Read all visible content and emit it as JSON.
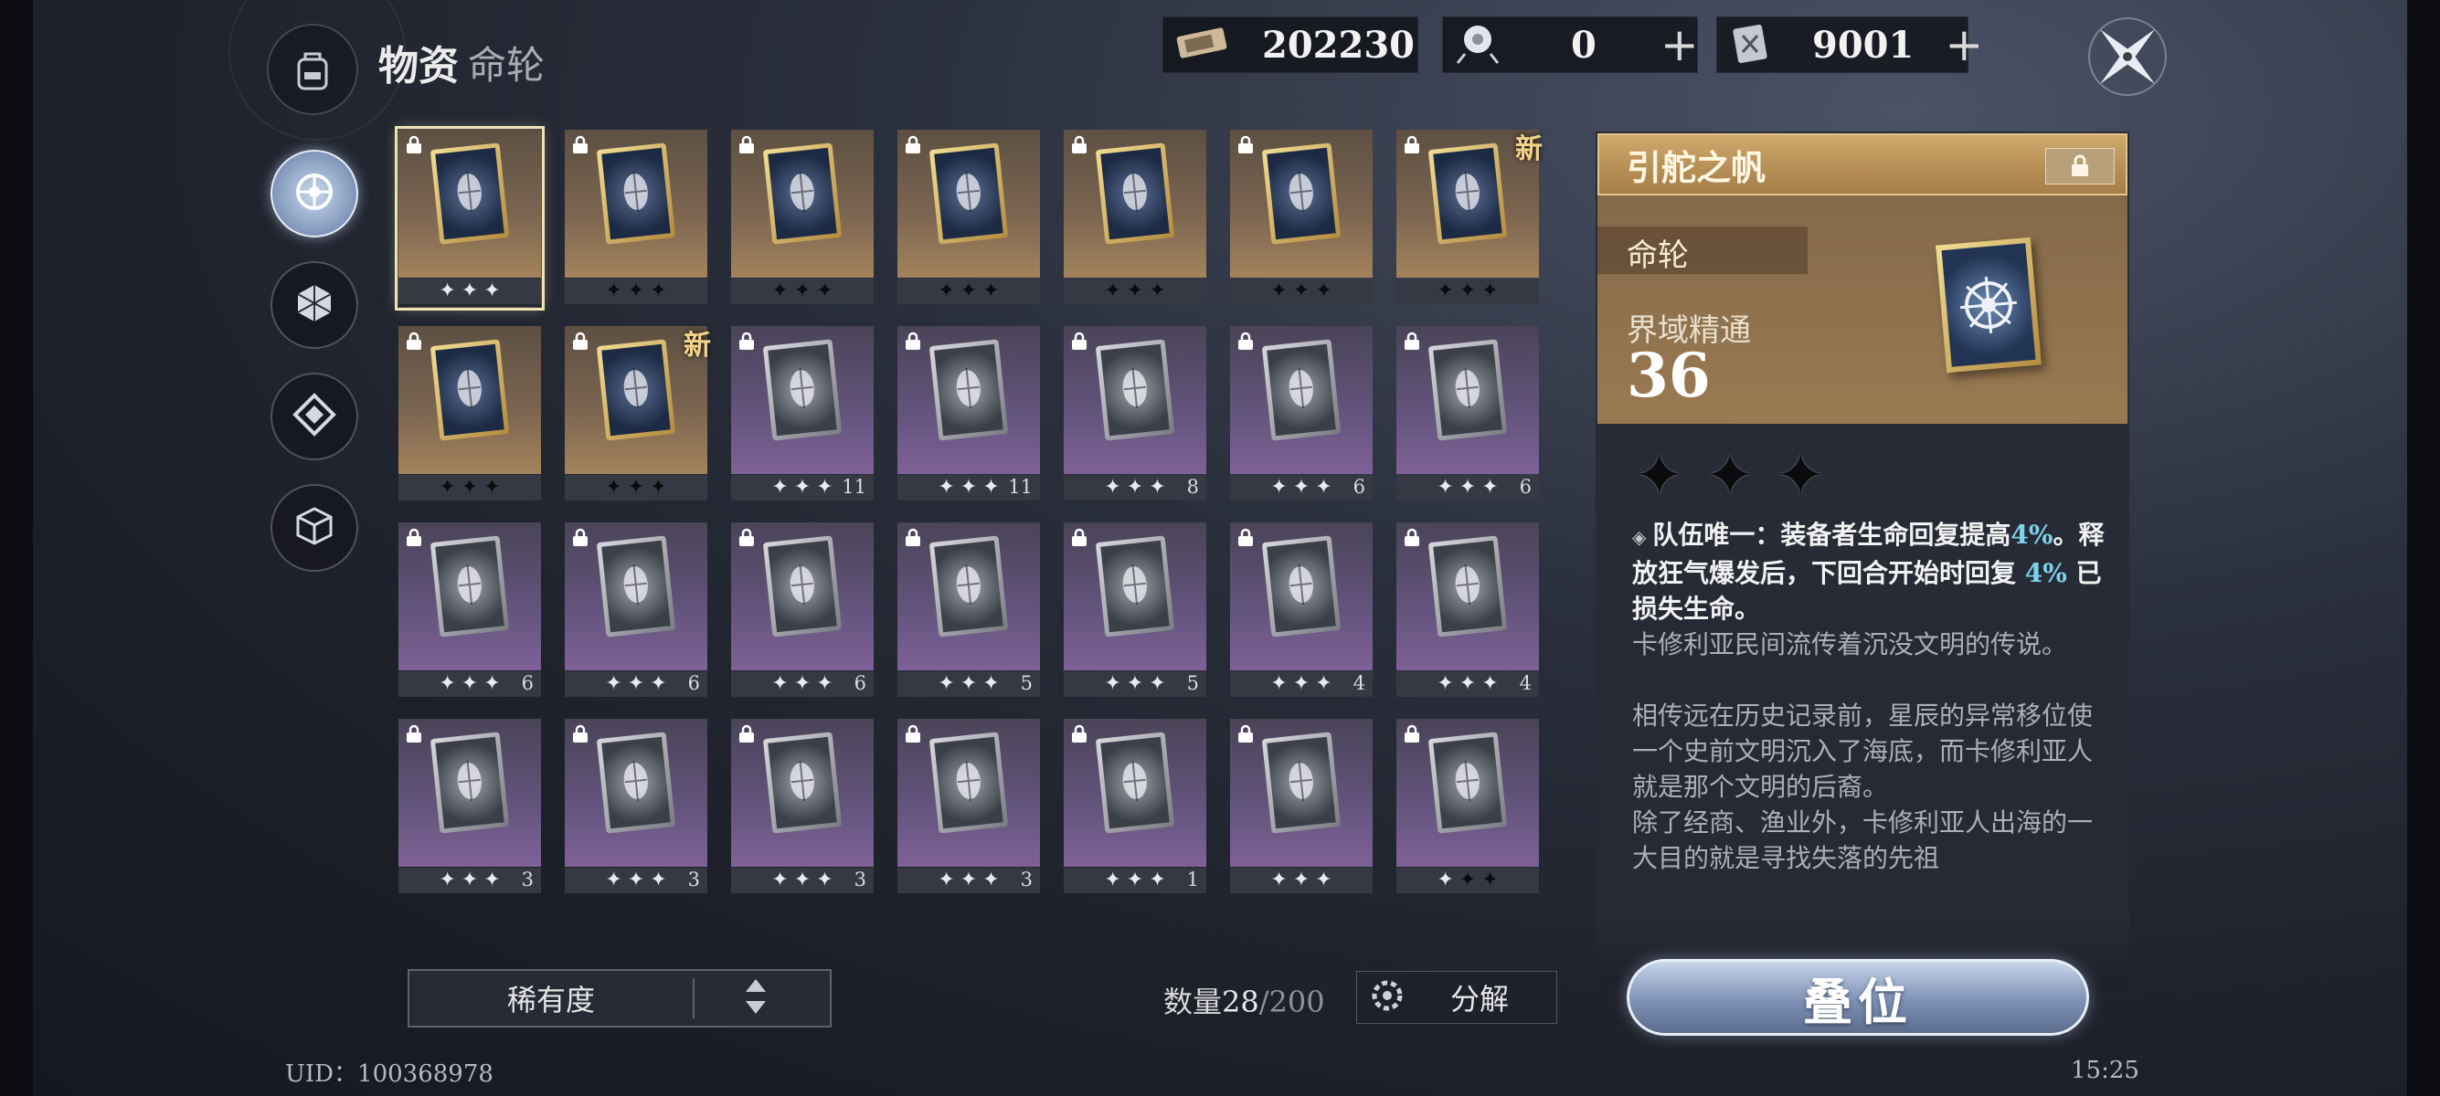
{
  "header": {
    "title": "物资",
    "subtitle": "命轮"
  },
  "currencies": [
    {
      "icon": "ticket-icon",
      "value": "202230",
      "plus": false
    },
    {
      "icon": "orb-icon",
      "value": "0",
      "plus": true,
      "plus_label": "+"
    },
    {
      "icon": "crystal-icon",
      "value": "9001",
      "plus": true,
      "plus_label": "+"
    }
  ],
  "nav": [
    "wheel-icon",
    "hexagon-icon",
    "diamond-icon",
    "cube-icon"
  ],
  "grid": [
    {
      "rarity": "gold",
      "icon": "wheel-icon",
      "stars": 3,
      "filled": 0,
      "level": "",
      "new": false,
      "selected": true
    },
    {
      "rarity": "gold",
      "icon": "figure-icon",
      "stars": 3,
      "filled": 3,
      "level": "",
      "new": false
    },
    {
      "rarity": "gold",
      "icon": "robe-icon",
      "stars": 3,
      "filled": 3,
      "level": "",
      "new": false
    },
    {
      "rarity": "gold",
      "icon": "sword-icon",
      "stars": 3,
      "filled": 3,
      "level": "",
      "new": false
    },
    {
      "rarity": "gold",
      "icon": "emblem-icon",
      "stars": 3,
      "filled": 3,
      "level": "",
      "new": false
    },
    {
      "rarity": "gold",
      "icon": "mirror-icon",
      "stars": 3,
      "filled": 3,
      "level": "",
      "new": false
    },
    {
      "rarity": "gold",
      "icon": "beast-icon",
      "stars": 3,
      "filled": 3,
      "level": "",
      "new": true
    },
    {
      "rarity": "gold",
      "icon": "beast-icon",
      "stars": 3,
      "filled": 3,
      "level": "",
      "new": false
    },
    {
      "rarity": "gold",
      "icon": "beast-icon",
      "stars": 3,
      "filled": 3,
      "level": "",
      "new": true
    },
    {
      "rarity": "purple",
      "icon": "staff-icon",
      "stars": 3,
      "filled": 0,
      "level": "11",
      "new": false
    },
    {
      "rarity": "purple",
      "icon": "shards-icon",
      "stars": 3,
      "filled": 0,
      "level": "11",
      "new": false
    },
    {
      "rarity": "purple",
      "icon": "hourglass-icon",
      "stars": 3,
      "filled": 0,
      "level": "8",
      "new": false
    },
    {
      "rarity": "purple",
      "icon": "flower-icon",
      "stars": 3,
      "filled": 0,
      "level": "6",
      "new": false
    },
    {
      "rarity": "purple",
      "icon": "spiral-icon",
      "stars": 3,
      "filled": 0,
      "level": "6",
      "new": false
    },
    {
      "rarity": "purple",
      "icon": "target-icon",
      "stars": 3,
      "filled": 0,
      "level": "6",
      "new": false
    },
    {
      "rarity": "purple",
      "icon": "key-icon",
      "stars": 3,
      "filled": 0,
      "level": "6",
      "new": false
    },
    {
      "rarity": "purple",
      "icon": "cat-icon",
      "stars": 3,
      "filled": 0,
      "level": "6",
      "new": false
    },
    {
      "rarity": "purple",
      "icon": "goblet-icon",
      "stars": 3,
      "filled": 0,
      "level": "5",
      "new": false
    },
    {
      "rarity": "purple",
      "icon": "cards-icon",
      "stars": 3,
      "filled": 0,
      "level": "5",
      "new": false
    },
    {
      "rarity": "purple",
      "icon": "papers-icon",
      "stars": 3,
      "filled": 0,
      "level": "4",
      "new": false
    },
    {
      "rarity": "purple",
      "icon": "fan-icon",
      "stars": 3,
      "filled": 0,
      "level": "4",
      "new": false
    },
    {
      "rarity": "purple",
      "icon": "claw-icon",
      "stars": 3,
      "filled": 0,
      "level": "3",
      "new": false
    },
    {
      "rarity": "purple",
      "icon": "shell-icon",
      "stars": 3,
      "filled": 0,
      "level": "3",
      "new": false
    },
    {
      "rarity": "purple",
      "icon": "scroll-icon",
      "stars": 3,
      "filled": 0,
      "level": "3",
      "new": false
    },
    {
      "rarity": "purple",
      "icon": "branch-icon",
      "stars": 3,
      "filled": 0,
      "level": "3",
      "new": false
    },
    {
      "rarity": "purple",
      "icon": "necklace-icon",
      "stars": 3,
      "filled": 0,
      "level": "1",
      "new": false
    },
    {
      "rarity": "purple",
      "icon": "pendant-icon",
      "stars": 3,
      "filled": 0,
      "level": "",
      "new": false
    },
    {
      "rarity": "purple",
      "icon": "coin-icon",
      "stars": 3,
      "filled": 2,
      "level": "",
      "new": false
    }
  ],
  "new_label": "新",
  "sort": {
    "label": "稀有度"
  },
  "count": {
    "prefix": "数量",
    "current": "28",
    "max": "/200"
  },
  "decompose_label": "分解",
  "uid": "UID：100368978",
  "clock": "15:25",
  "detail": {
    "name": "引舵之帆",
    "type": "命轮",
    "stat_label": "界域精通",
    "stat_value": "36",
    "stars_filled": 3,
    "effect_1": "队伍唯一：装备者生命回复提高",
    "effect_2": "4%",
    "effect_3": "。释放狂气爆发后，下回合开始时回复",
    "effect_4": "4%",
    "effect_5": "已损失生命。",
    "lore": "卡修利亚民间流传着沉没文明的传说。\n\n相传远在历史记录前，星辰的异常移位使一个史前文明沉入了海底，而卡修利亚人就是那个文明的后裔。\n除了经商、渔业外，卡修利亚人出海的一大目的就是寻找失落的先祖"
  },
  "stack_label": "叠位",
  "colors": {
    "gold": "#a3835c",
    "purple": "#7e6197",
    "highlight": "#7dd3ec"
  }
}
